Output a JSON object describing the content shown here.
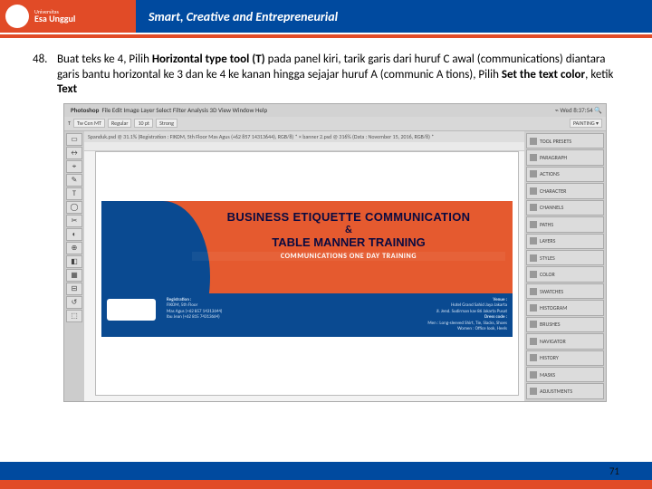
{
  "banner": {
    "university_small": "Universitas",
    "university": "Esa Unggul",
    "tagline": "Smart, Creative and Entrepreneurial"
  },
  "instruction": {
    "number": "48.",
    "seg1": "Buat teks ke 4, Pilih ",
    "seg2_bold": "Horizontal type tool (T) ",
    "seg3": "pada panel kiri, tarik garis dari huruf C awal (communications) diantara garis bantu horizontal ke 3 dan ke 4 ke kanan hingga sejajar huruf A (communic A tions), Pilih ",
    "seg4_bold": "Set the text color",
    "seg5": ", ketik ",
    "seg6_bold": "Text"
  },
  "photoshop": {
    "app": "Photoshop",
    "menu": "File  Edit  Image  Layer  Select  Filter  Analysis  3D  View  Window  Help",
    "clock": "Wed 8:37:54",
    "options_font": "Tw Cen MT",
    "options_style": "Regular",
    "options_size": "10 pt",
    "options_aa": "Strong",
    "mode_label": "PAINTING ▾",
    "tab": "Spanduk.psd @ 31.1% (Registration : FIKOM, 5th Floor Mas Agus (+62 857 14313644), RGB/8) *   ×  banner 2.psd @ 316% (Data : November 15, 2016, RGB/8) *",
    "panels": [
      "TOOL PRESETS",
      "PARAGRAPH",
      "ACTIONS",
      "CHARACTER",
      "CHANNELS",
      "PATHS",
      "LAYERS",
      "STYLES",
      "COLOR",
      "SWATCHES",
      "HISTOGRAM",
      "BRUSHES",
      "NAVIGATOR",
      "HISTORY",
      "MASKS",
      "ADJUSTMENTS"
    ],
    "tools": [
      "▭",
      "↔",
      "⌖",
      "✎",
      "T",
      "◯",
      "✂",
      "◐",
      "⊕",
      "◧",
      "▦",
      "⊟",
      "↺",
      "⬚"
    ]
  },
  "art": {
    "line1": "BUSINESS ETIQUETTE COMMUNICATION",
    "amp": "&",
    "line2": "TABLE MANNER TRAINING",
    "line3": "COMMUNICATIONS ONE DAY TRAINING",
    "reg_title": "Registration :",
    "reg1": "FIKOM, 5th Floor",
    "reg2": "Mas Agus (+62 857 14313644)",
    "reg3": "Ibu Jean (+62 815 74313664)",
    "venue_title": "Venue :",
    "venue1": "Hotel Grand Sahid Jaya Jakarta",
    "venue2": "Jl. Jend. Sudirman kav 86 Jakarta Pusat",
    "dress": "Dress code :",
    "dress1": "Men : Long-sleeved Shirt, Tie, Slacks, Shoes",
    "dress2": "Women : Office look, Heels"
  },
  "footer": {
    "page": "71"
  }
}
